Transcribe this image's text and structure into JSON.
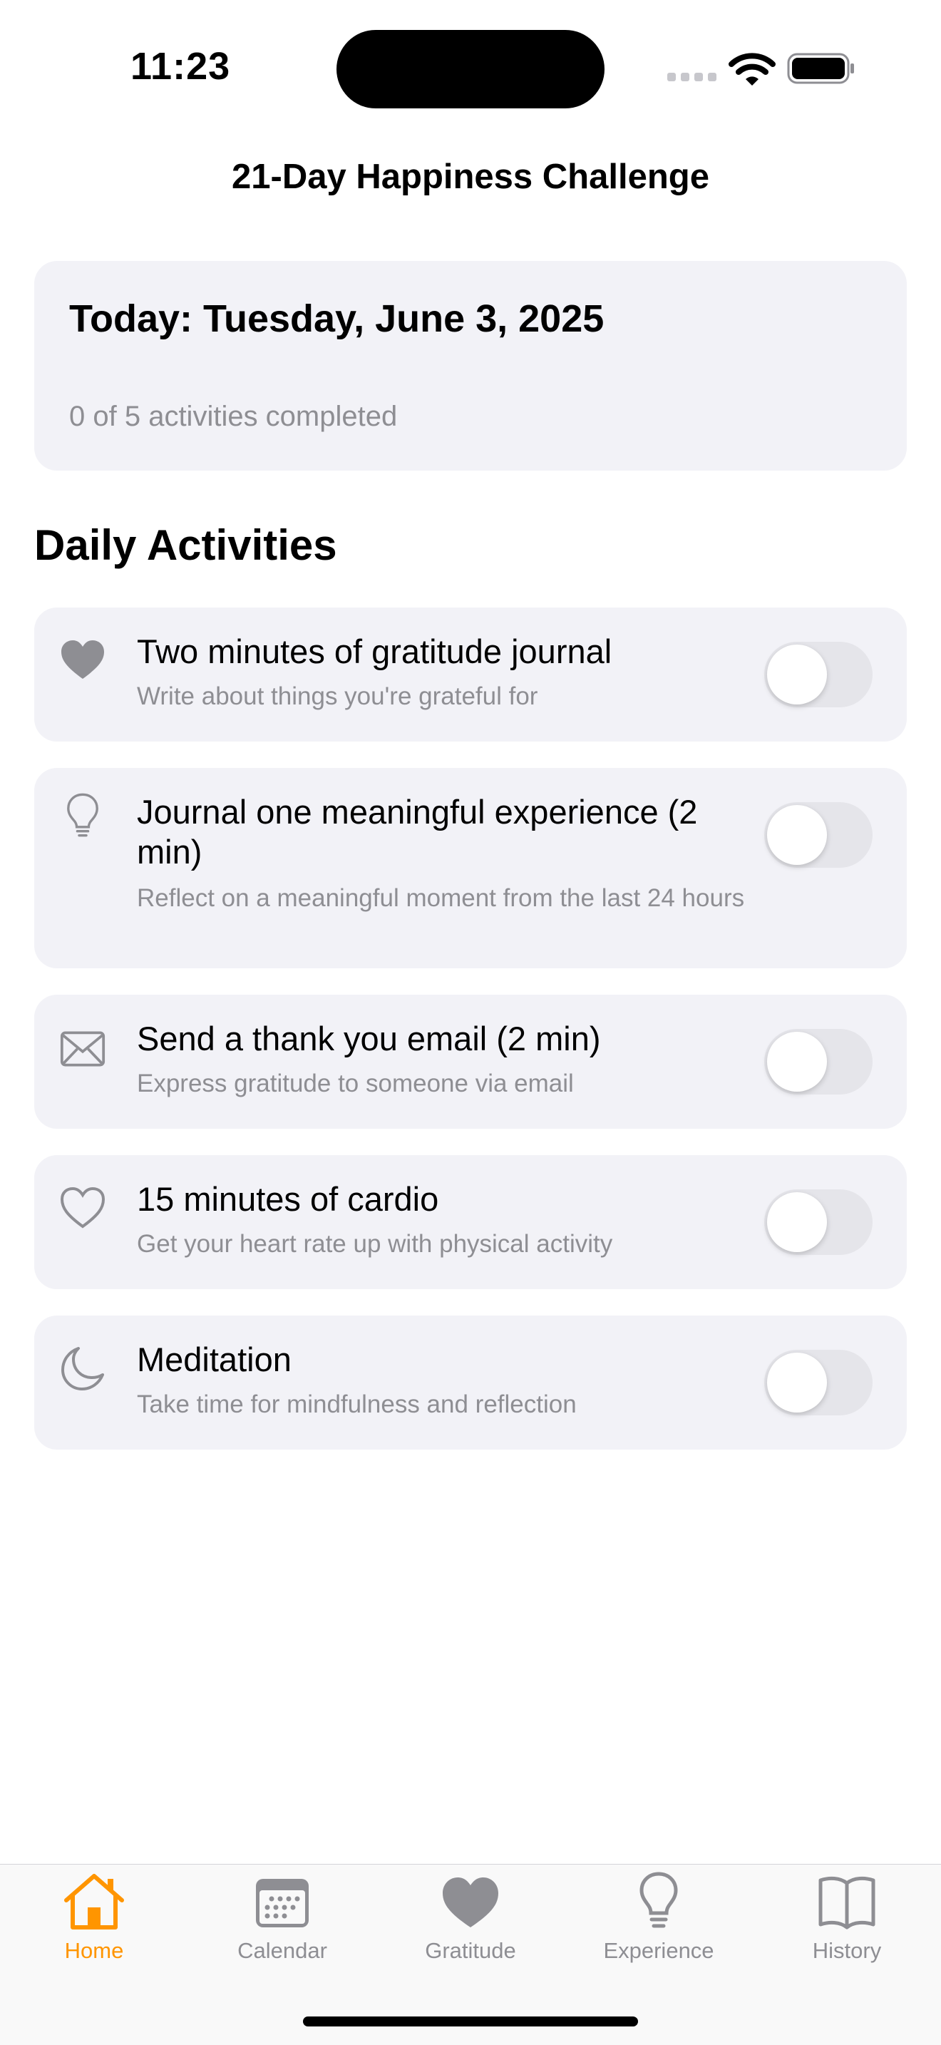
{
  "status_bar": {
    "time": "11:23"
  },
  "nav": {
    "title": "21-Day Happiness Challenge"
  },
  "today": {
    "title": "Today: Tuesday, June 3, 2025",
    "progress_text": "0 of 5 activities completed",
    "completed": 0,
    "total": 5
  },
  "section": {
    "title": "Daily Activities"
  },
  "activities": [
    {
      "icon": "heart-fill-icon",
      "title": "Two minutes of gratitude journal",
      "description": "Write about things you're grateful for",
      "done": false
    },
    {
      "icon": "lightbulb-icon",
      "title": "Journal one meaningful experience (2 min)",
      "description": "Reflect on a meaningful moment from the last 24 hours",
      "done": false
    },
    {
      "icon": "envelope-icon",
      "title": "Send a thank you email (2 min)",
      "description": "Express gratitude to someone via email",
      "done": false
    },
    {
      "icon": "heart-outline-icon",
      "title": "15 minutes of cardio",
      "description": "Get your heart rate up with physical activity",
      "done": false
    },
    {
      "icon": "moon-icon",
      "title": "Meditation",
      "description": "Take time for mindfulness and reflection",
      "done": false
    }
  ],
  "tabs": [
    {
      "label": "Home",
      "icon": "house-icon",
      "active": true
    },
    {
      "label": "Calendar",
      "icon": "calendar-icon",
      "active": false
    },
    {
      "label": "Gratitude",
      "icon": "heart-icon",
      "active": false
    },
    {
      "label": "Experience",
      "icon": "lightbulb-icon",
      "active": false
    },
    {
      "label": "History",
      "icon": "book-icon",
      "active": false
    }
  ],
  "colors": {
    "accent": "#ff9500",
    "card_background": "#f2f2f7",
    "secondary_text": "#8e8e93",
    "toggle_off": "#e5e5ea",
    "icon_gray": "#8e8e93"
  }
}
